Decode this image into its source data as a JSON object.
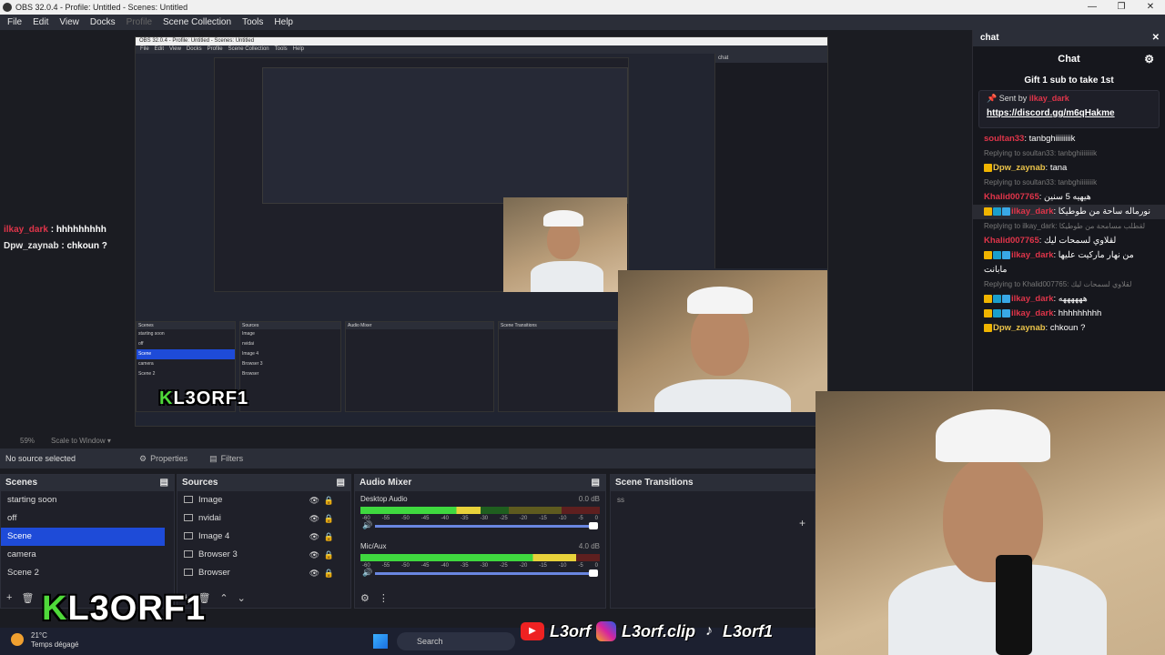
{
  "window": {
    "title": "OBS 32.0.4 - Profile: Untitled - Scenes: Untitled",
    "controls": [
      "—",
      "❐",
      "✕"
    ]
  },
  "menu": {
    "items": [
      "File",
      "Edit",
      "View",
      "Docks",
      "Profile",
      "Scene Collection",
      "Tools",
      "Help"
    ]
  },
  "overlay_chat": [
    {
      "user": "ilkay_dark",
      "sep": " : ",
      "text": "hhhhhhhhh"
    },
    {
      "user": "Dpw_zaynab",
      "sep": " : ",
      "text": "chkoun ?"
    }
  ],
  "logo": {
    "prefix": "K",
    "rest": "L3ORF1"
  },
  "preview_bar": {
    "zoom": "59%",
    "scale_mode": "Scale to Window"
  },
  "props": {
    "no_source": "No source selected",
    "properties": "Properties",
    "filters": "Filters"
  },
  "scenes": {
    "title": "Scenes",
    "items": [
      "starting soon",
      "off",
      "Scene",
      "camera",
      "Scene 2"
    ],
    "selected": 2
  },
  "sources": {
    "title": "Sources",
    "items": [
      "Image",
      "nvidai",
      "Image 4",
      "Browser 3",
      "Browser"
    ]
  },
  "mixer": {
    "title": "Audio Mixer",
    "channels": [
      {
        "name": "Desktop Audio",
        "db": "0.0 dB",
        "level": 0.5
      },
      {
        "name": "Mic/Aux",
        "db": "4.0 dB",
        "level": 0.9
      }
    ],
    "scale": [
      "-60",
      "-55",
      "-50",
      "-45",
      "-40",
      "-35",
      "-30",
      "-25",
      "-20",
      "-15",
      "-10",
      "-5",
      "0"
    ]
  },
  "transitions": {
    "title": "Scene Transitions",
    "value": "ss"
  },
  "chat_dock": {
    "dock_title": "chat",
    "title": "Chat",
    "pinned": "Gift 1 sub to take 1st",
    "sent_by": "Sent by",
    "sent_user": "ilkay_dark",
    "link": "https://discord.gg/m6qHakme",
    "messages": [
      {
        "user": "soultan33",
        "text": "tanbghiiiiiiiik",
        "color": "red"
      },
      {
        "reply": "Replying to soultan33: tanbghiiiiiiiik"
      },
      {
        "user": "Dpw_zaynab",
        "text": "tana",
        "color": "yel"
      },
      {
        "reply": "Replying to soultan33: tanbghiiiiiiiik"
      },
      {
        "user": "Khalid007765",
        "text": "هيهيه 5 سنين",
        "color": "red"
      },
      {
        "user": "ilkay_dark",
        "text": "نورماله ساحة من طوطيكا",
        "color": "red",
        "hl": true
      },
      {
        "reply": "Replying to ilkay_dark: لقطلب مسامحة من طوطيكا"
      },
      {
        "user": "Khalid007765",
        "text": "لقلاوي لسمحات ليك",
        "color": "red"
      },
      {
        "user": "ilkay_dark",
        "text": "من نهار ماركيت عليها مابانت",
        "color": "red"
      },
      {
        "reply": "Replying to Khalid007765: لقلاوي لسمحات ليك"
      },
      {
        "user": "ilkay_dark",
        "text": "ههههههه",
        "color": "red"
      },
      {
        "user": "ilkay_dark",
        "text": "hhhhhhhhh",
        "color": "red"
      },
      {
        "user": "Dpw_zaynab",
        "text": "chkoun ?",
        "color": "yel"
      }
    ]
  },
  "taskbar": {
    "temp": "21°C",
    "weather": "Temps dégagé",
    "search": "Search"
  },
  "social": {
    "yt": "L3orf",
    "ig": "L3orf.clip",
    "tt": "L3orf1"
  },
  "colors": {
    "accent": "#1e4bd8",
    "username_red": "#e0354a",
    "logo_green": "#4fd93a"
  }
}
